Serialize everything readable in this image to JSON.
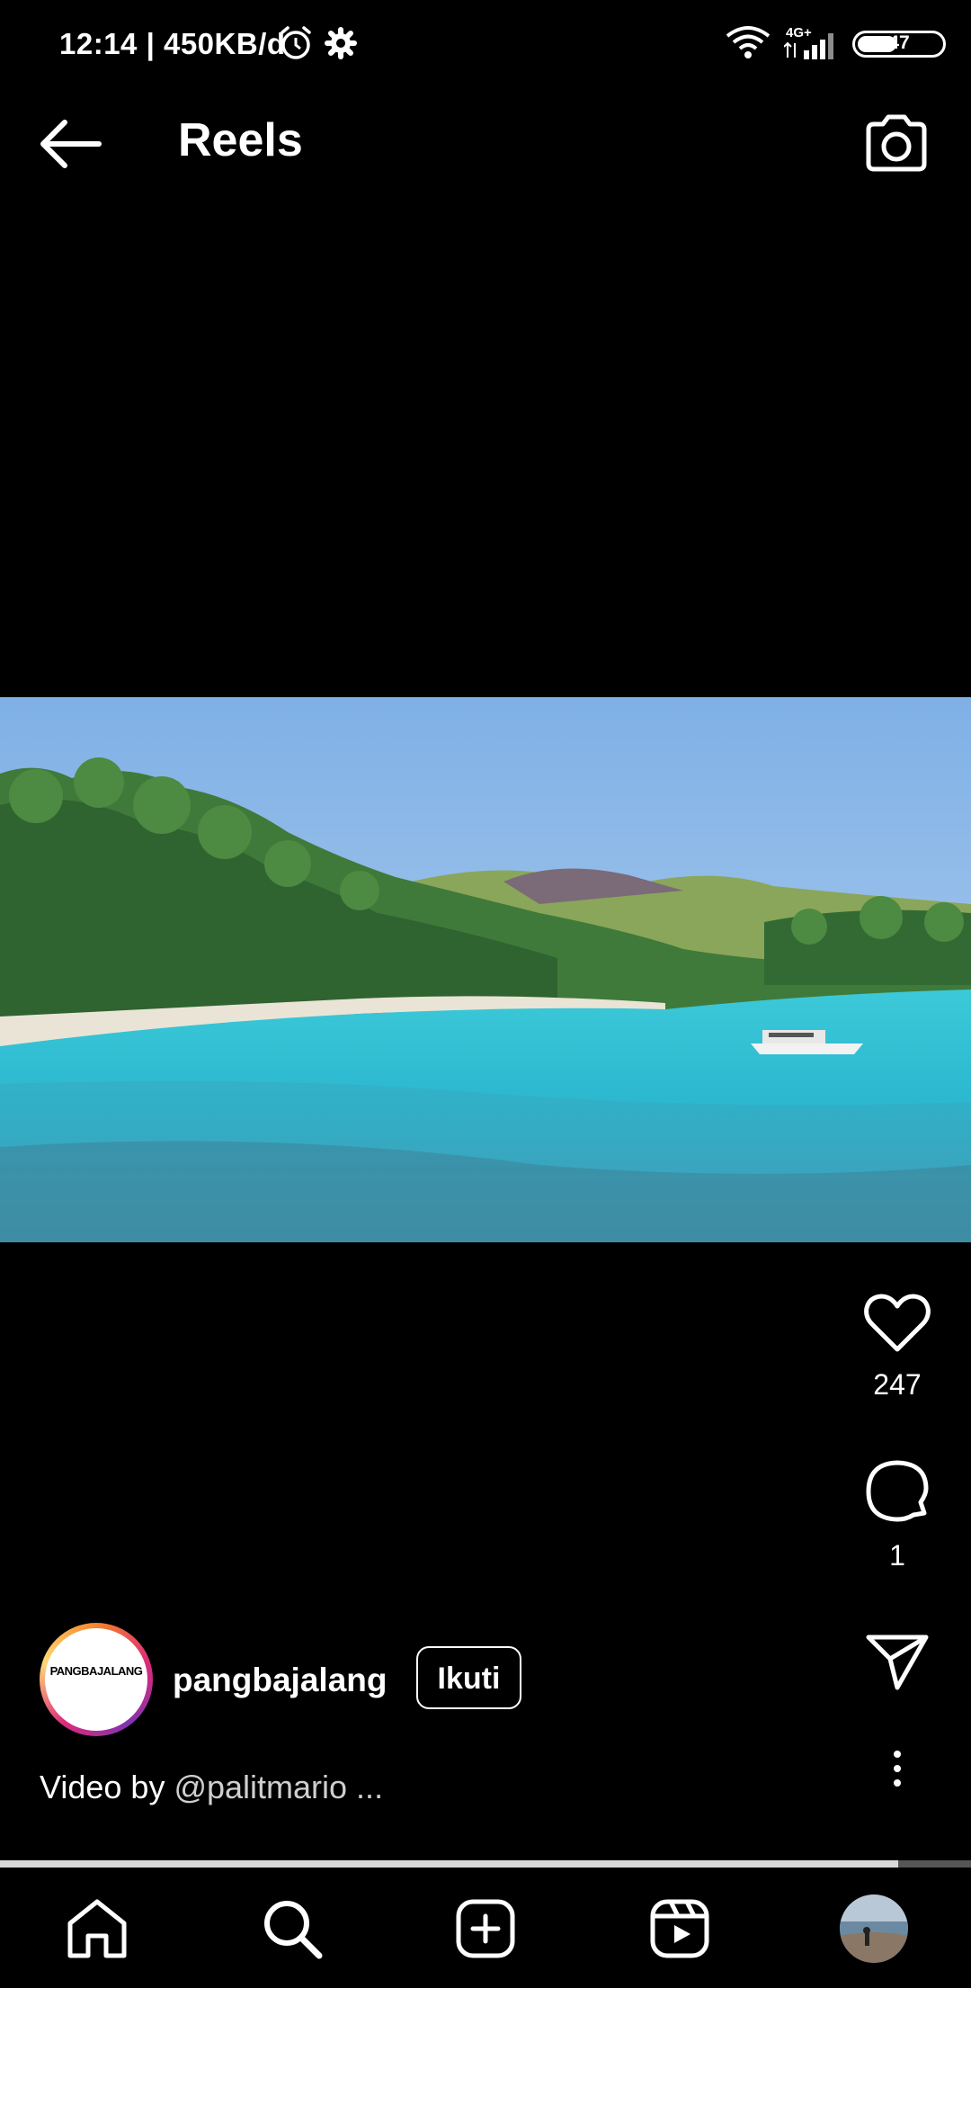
{
  "status_bar": {
    "time_text": "12:14 | 450KB/d",
    "network_label": "4G+",
    "battery_level": "47",
    "icons": [
      "alarm-icon",
      "settings-icon",
      "wifi-icon",
      "signal-icon",
      "battery-icon"
    ]
  },
  "header": {
    "title": "Reels",
    "back_icon": "arrow-left-icon",
    "camera_icon": "camera-icon"
  },
  "actions": {
    "like_count": "247",
    "comment_count": "1"
  },
  "post": {
    "avatar_text": "PANGBAJALANG",
    "username": "pangbajalang",
    "follow_label": "Ikuti",
    "caption_lead": "Video by ",
    "caption_mention": "@palitmario ..."
  },
  "playback": {
    "progress_fraction": 0.925
  },
  "bottom_nav": {
    "items": [
      "home-icon",
      "search-icon",
      "add-post-icon",
      "reels-icon",
      "profile-avatar"
    ]
  },
  "colors": {
    "background": "#000000",
    "accent_ring": "#dd2a7b"
  }
}
